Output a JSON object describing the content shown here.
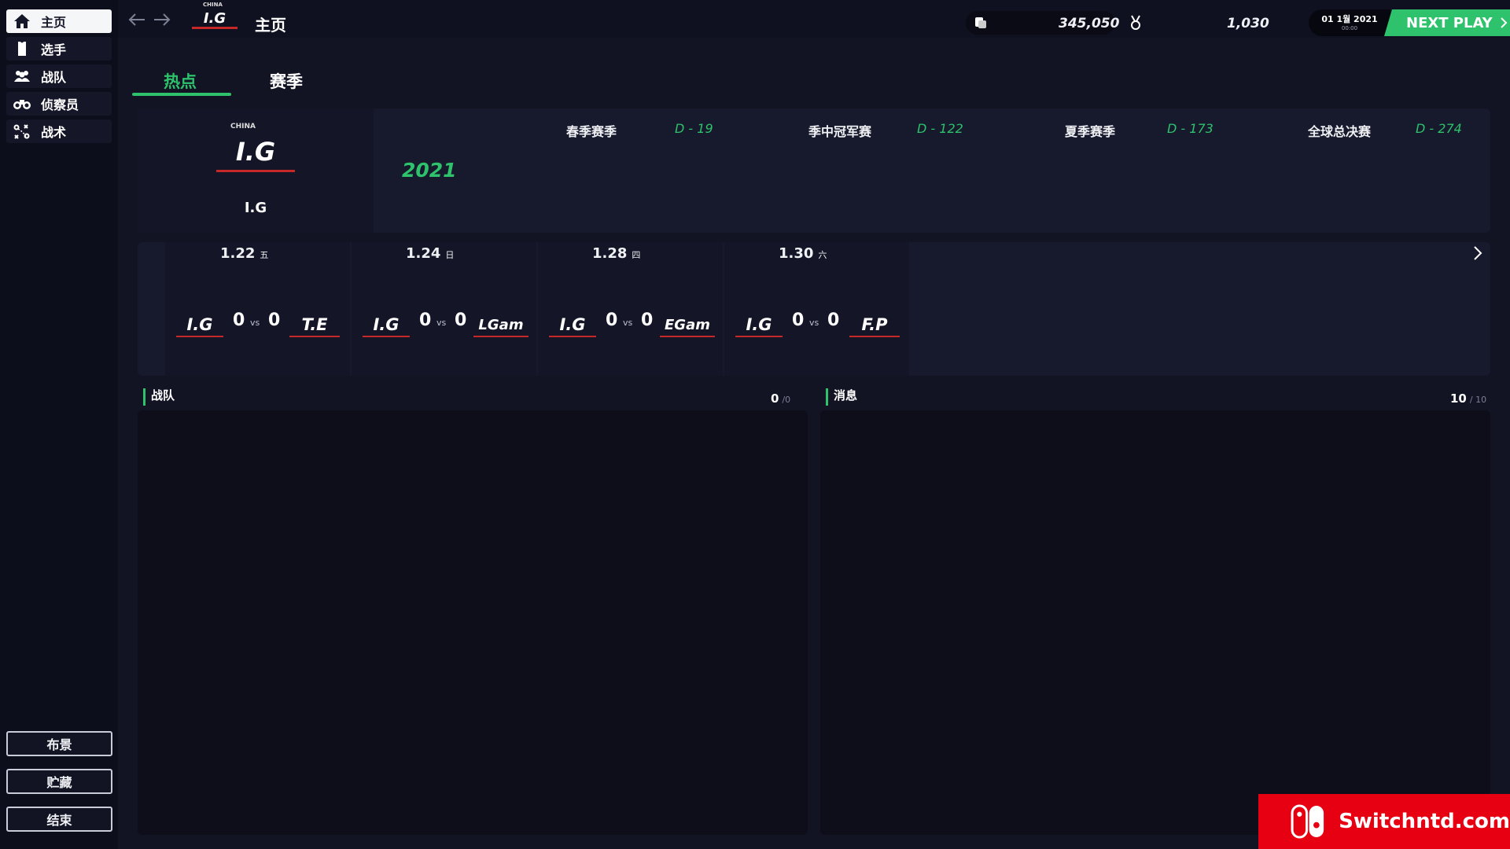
{
  "sidebar": {
    "items": [
      {
        "label": "主页",
        "icon": "home-icon",
        "active": true
      },
      {
        "label": "选手",
        "icon": "jersey-icon",
        "active": false
      },
      {
        "label": "战队",
        "icon": "team-icon",
        "active": false
      },
      {
        "label": "侦察员",
        "icon": "binoculars-icon",
        "active": false
      },
      {
        "label": "战术",
        "icon": "tactics-icon",
        "active": false
      }
    ],
    "bottom_buttons": [
      "布景",
      "贮藏",
      "结束"
    ]
  },
  "header": {
    "title": "主页",
    "team_logo_text": "I.G",
    "logo_country": "CHINA",
    "money": "345,050",
    "fans": "1,030",
    "date": "01 1월 2021",
    "time": "00:00",
    "next_play": "NEXT PLAY"
  },
  "tabs": [
    {
      "label": "热点",
      "active": true
    },
    {
      "label": "赛季",
      "active": false
    }
  ],
  "season": {
    "team_name": "I.G",
    "year": "2021",
    "events": [
      {
        "name": "春季赛季",
        "days": "D - 19"
      },
      {
        "name": "季中冠军赛",
        "days": "D - 122"
      },
      {
        "name": "夏季赛季",
        "days": "D - 173"
      },
      {
        "name": "全球总决赛",
        "days": "D - 274"
      }
    ]
  },
  "matches": [
    {
      "date": "1.22",
      "day": "五",
      "home": "I.G",
      "away": "T.E",
      "home_score": "0",
      "away_score": "0",
      "vs": "vs"
    },
    {
      "date": "1.24",
      "day": "日",
      "home": "I.G",
      "away": "LGam",
      "home_score": "0",
      "away_score": "0",
      "vs": "vs"
    },
    {
      "date": "1.28",
      "day": "四",
      "home": "I.G",
      "away": "EGam",
      "home_score": "0",
      "away_score": "0",
      "vs": "vs"
    },
    {
      "date": "1.30",
      "day": "六",
      "home": "I.G",
      "away": "F.P",
      "home_score": "0",
      "away_score": "0",
      "vs": "vs"
    }
  ],
  "team_panel": {
    "title": "战队",
    "count": "0",
    "max": "/0"
  },
  "message_panel": {
    "title": "消息",
    "count": "10",
    "max": "/ 10"
  },
  "watermark": "Switchntd.com",
  "colors": {
    "accent": "#2dc26b",
    "background": "#121424",
    "watermark": "#e60012"
  }
}
